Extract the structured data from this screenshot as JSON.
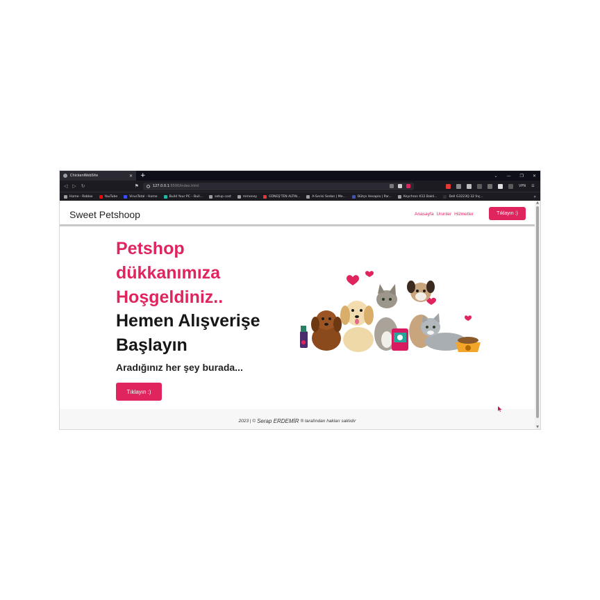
{
  "browser": {
    "tab_title": "ChickenWebSite",
    "url_host": "127.0.0.1",
    "url_path": ":5500/index.html",
    "vpn_label": "VPN",
    "bookmarks": [
      {
        "label": "Home - Roblox",
        "color": "#9e9e9e"
      },
      {
        "label": "YouTube",
        "color": "#ff0000"
      },
      {
        "label": "VirusTotal - Home",
        "color": "#394eff"
      },
      {
        "label": "Build Your PC – Buil...",
        "color": "#21b8a6"
      },
      {
        "label": "setup cost",
        "color": "#9e9e9e"
      },
      {
        "label": "mmoney",
        "color": "#9e9e9e"
      },
      {
        "label": "GÜNEŞ'TEN ALTIN...",
        "color": "#e53935"
      },
      {
        "label": "A-Serisi Sedan | Me...",
        "color": "#9e9e9e"
      },
      {
        "label": "Bütçe Hesapla | Par...",
        "color": "#3f51b5"
      },
      {
        "label": "Keychron K12 Bakli...",
        "color": "#9e9e9e"
      },
      {
        "label": "Dell G3223Q 32 İnç...",
        "color": "#333333"
      }
    ]
  },
  "site": {
    "brand": "Sweet Petshoop",
    "nav": [
      "Anasayfa",
      "Urunler",
      "Hizmetler"
    ],
    "nav_cta": "Tıklayın :)",
    "hero_pink": [
      "Petshop",
      "dükkanımıza",
      "Hoşgeldiniz.."
    ],
    "hero_dark": [
      "Hemen Alışverişe",
      "Başlayın"
    ],
    "subheading": "Aradığınız her şey burada...",
    "hero_cta": "Tıklayın :)",
    "footer": {
      "prefix": "2023 | ©",
      "author": "Serap ERDEMİR",
      "suffix": "® tarafından hakları saklıdır"
    }
  },
  "colors": {
    "accent": "#e0245e",
    "chrome_dark": "#1c1b22"
  }
}
